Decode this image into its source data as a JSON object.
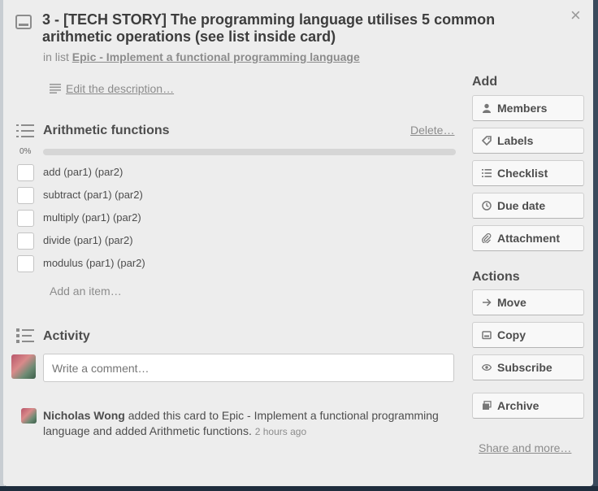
{
  "card": {
    "title": "3 - [TECH STORY] The programming language utilises 5 common arithmetic operations (see list inside card)",
    "in_list_prefix": "in list",
    "list_name": "Epic - Implement a functional programming language",
    "close_glyph": "×"
  },
  "description": {
    "edit_label": "Edit the description…"
  },
  "checklist": {
    "title": "Arithmetic functions",
    "delete_label": "Delete…",
    "progress_label": "0%",
    "progress": 0,
    "items": [
      {
        "label": "add (par1) (par2)",
        "checked": false
      },
      {
        "label": "subtract (par1) (par2)",
        "checked": false
      },
      {
        "label": "multiply (par1) (par2)",
        "checked": false
      },
      {
        "label": "divide (par1) (par2)",
        "checked": false
      },
      {
        "label": "modulus (par1) (par2)",
        "checked": false
      }
    ],
    "add_item_placeholder": "Add an item…"
  },
  "activity": {
    "title": "Activity",
    "comment_placeholder": "Write a comment…",
    "entry": {
      "user": "Nicholas Wong",
      "text": " added this card to Epic - Implement a functional programming language and added Arithmetic functions.",
      "time": "2 hours ago"
    }
  },
  "sidebar": {
    "add_heading": "Add",
    "add_buttons": [
      {
        "label": "Members",
        "icon": "person-icon"
      },
      {
        "label": "Labels",
        "icon": "tag-icon"
      },
      {
        "label": "Checklist",
        "icon": "checklist-icon"
      },
      {
        "label": "Due date",
        "icon": "clock-icon"
      },
      {
        "label": "Attachment",
        "icon": "paperclip-icon"
      }
    ],
    "actions_heading": "Actions",
    "action_buttons": [
      {
        "label": "Move",
        "icon": "arrow-right-icon"
      },
      {
        "label": "Copy",
        "icon": "copy-icon"
      },
      {
        "label": "Subscribe",
        "icon": "eye-icon"
      },
      {
        "label": "Archive",
        "icon": "archive-icon"
      }
    ],
    "share_label": "Share and more…"
  },
  "colors": {
    "progress_fill": "#5ba4cf",
    "modal_bg": "#ededed"
  }
}
